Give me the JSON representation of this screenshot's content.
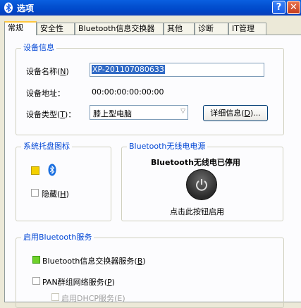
{
  "window": {
    "title": "选项"
  },
  "tabs": [
    "常规",
    "安全性",
    "Bluetooth信息交换器",
    "其他",
    "诊断",
    "IT管理"
  ],
  "device_info": {
    "legend": "设备信息",
    "name_label": "设备名称",
    "name_key": "N",
    "name_value": "XP-201107080633",
    "address_label": "设备地址：",
    "address_value": "00:00:00:00:00:00",
    "type_label": "设备类型",
    "type_key": "T",
    "type_value": "膝上型电脑",
    "details_button": "详细信息",
    "details_key": "D",
    "details_suffix": "..."
  },
  "tray": {
    "legend": "系统托盘图标",
    "hide_label": "隐藏",
    "hide_key": "H"
  },
  "power": {
    "legend": "Bluetooth无线电电源",
    "status": "Bluetooth无线电已停用",
    "hint": "点击此按钮启用"
  },
  "services": {
    "legend": "启用Bluetooth服务",
    "items": [
      {
        "label": "Bluetooth信息交换器服务",
        "key": "B"
      },
      {
        "label": "PAN群组网络服务",
        "key": "P"
      },
      {
        "label": "启用DHCP服务",
        "key": "E"
      }
    ]
  },
  "colors": {
    "title_bar": "#0054e3",
    "legend": "#0046d5",
    "active_tab_accent": "#ffc73c"
  }
}
